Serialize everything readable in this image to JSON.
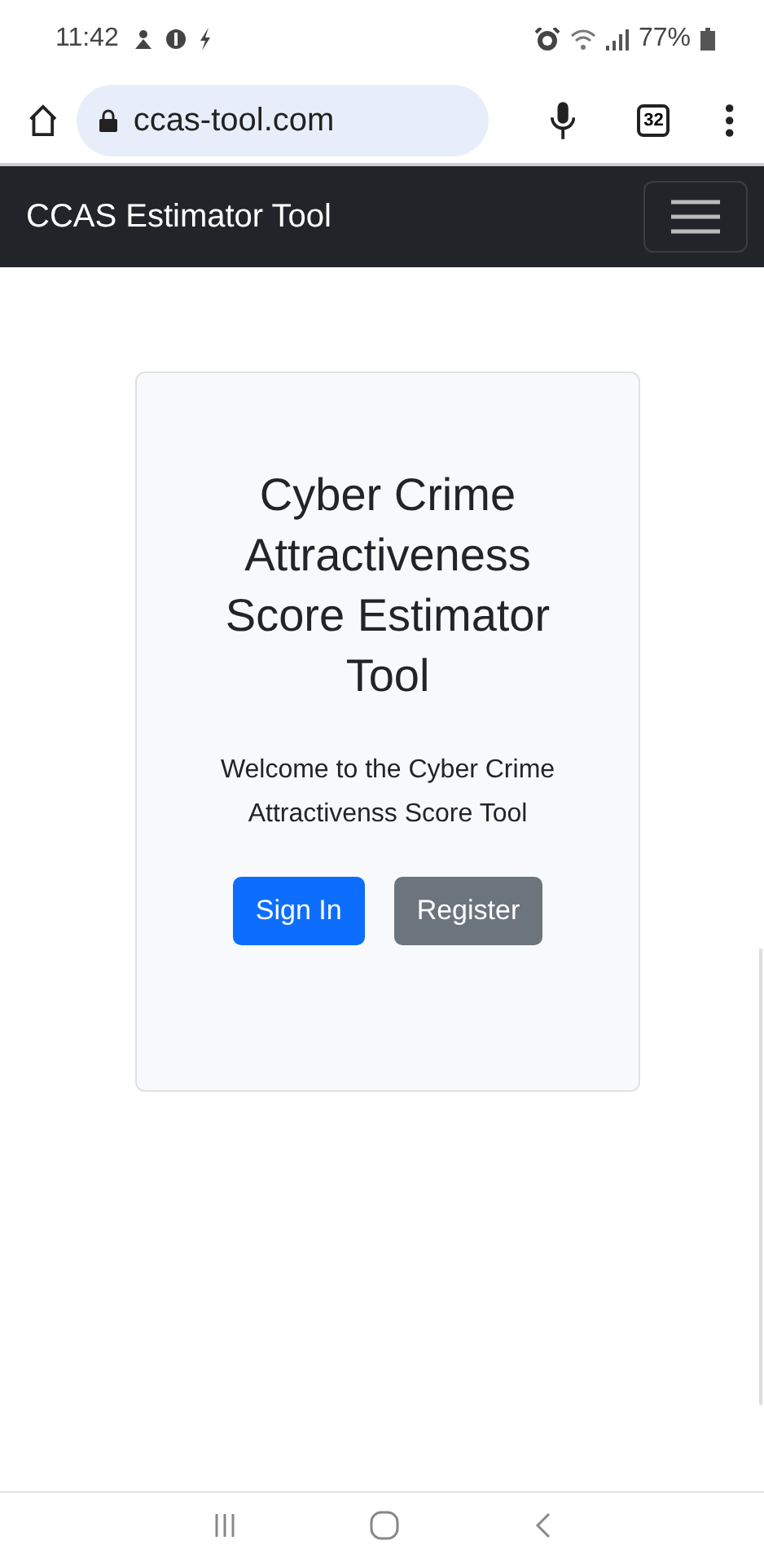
{
  "status_bar": {
    "time": "11:42",
    "battery": "77%"
  },
  "browser": {
    "url": "ccas-tool.com",
    "tab_count": "32"
  },
  "navbar": {
    "brand": "CCAS Estimator Tool"
  },
  "card": {
    "title": "Cyber Crime Attractiveness Score Estimator Tool",
    "text": "Welcome to the Cyber Crime Attractivenss Score Tool",
    "buttons": [
      {
        "label": "Sign In",
        "kind": "primary"
      },
      {
        "label": "Register",
        "kind": "secondary"
      }
    ]
  }
}
